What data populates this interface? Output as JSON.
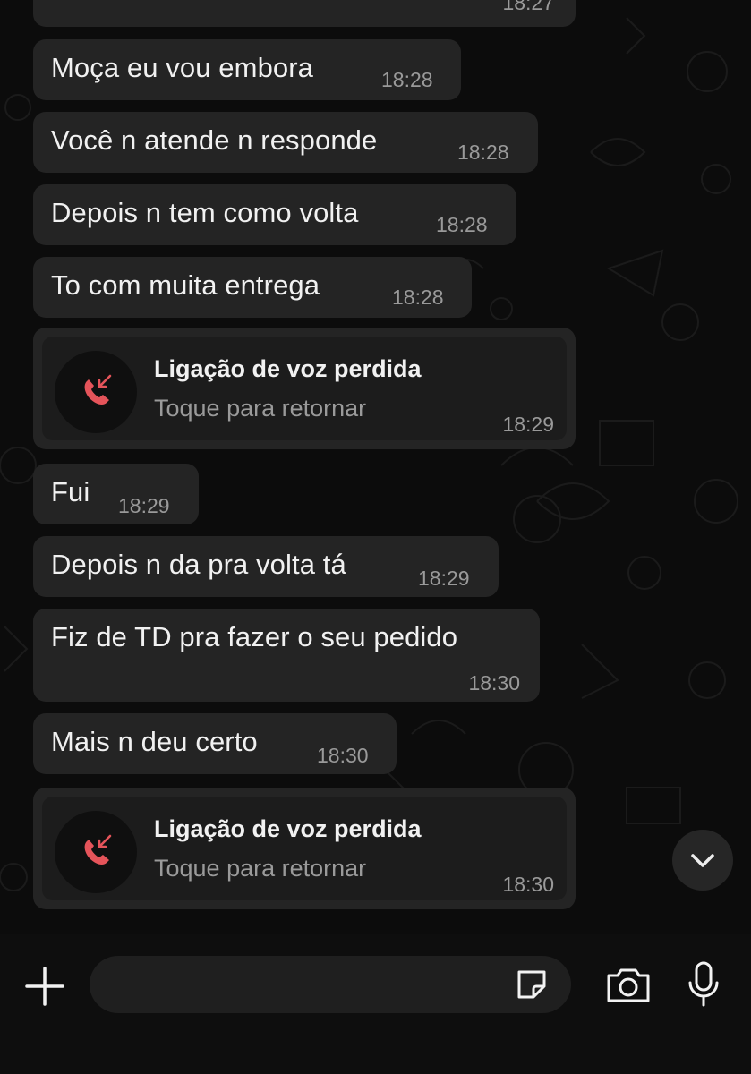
{
  "chat": {
    "top_partial_time": "18:27",
    "messages": [
      {
        "text": "Moça eu vou embora",
        "time": "18:28"
      },
      {
        "text": "Você n atende n responde",
        "time": "18:28"
      },
      {
        "text": "Depois n tem como volta",
        "time": "18:28"
      },
      {
        "text": "To com muita entrega",
        "time": "18:28"
      },
      {
        "text": "Fui",
        "time": "18:29"
      },
      {
        "text": "Depois n da pra volta tá",
        "time": "18:29"
      },
      {
        "text": "Fiz de TD pra fazer o seu pedido",
        "time": "18:30"
      },
      {
        "text": "Mais n deu certo",
        "time": "18:30"
      }
    ],
    "calls": [
      {
        "title": "Ligação de voz perdida",
        "subtitle": "Toque para retornar",
        "time": "18:29",
        "icon": "missed-call-icon"
      },
      {
        "title": "Ligação de voz perdida",
        "subtitle": "Toque para retornar",
        "time": "18:30",
        "icon": "missed-call-icon"
      }
    ]
  },
  "composer": {
    "input_value": "",
    "icons": [
      "plus-icon",
      "sticker-icon",
      "camera-icon",
      "microphone-icon"
    ]
  },
  "scroll_button_icon": "chevron-down-icon",
  "colors": {
    "background": "#0b0b0b",
    "bubble": "#242424",
    "missed_call": "#e5545a"
  }
}
